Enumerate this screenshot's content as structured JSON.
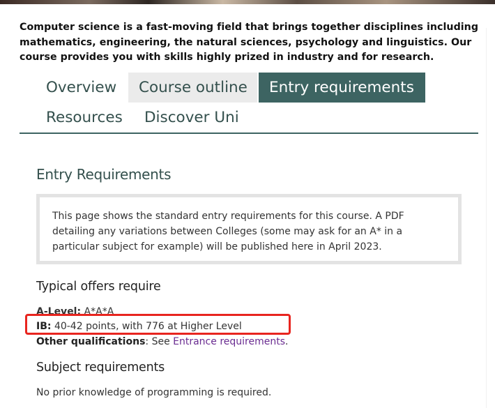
{
  "intro": "Computer science is a fast-moving field that brings together disciplines including mathematics, engineering, the natural sciences, psychology and linguistics. Our course provides you with skills highly prized in industry and for research.",
  "tabs": [
    {
      "label": "Overview"
    },
    {
      "label": "Course outline"
    },
    {
      "label": "Entry requirements"
    },
    {
      "label": "Resources"
    },
    {
      "label": "Discover Uni"
    }
  ],
  "section_title": "Entry Requirements",
  "notice": "This page shows the standard entry requirements for this course. A PDF detailing any variations between Colleges (some may ask for an A* in a particular subject for example) will be published here in April 2023.",
  "typical_offers": {
    "heading": "Typical offers require",
    "a_level_label": "A-Level:",
    "a_level_value": "A*A*A",
    "ib_label": "IB:",
    "ib_value": "40-42 points, with 776 at Higher Level",
    "other_label": "Other qualifications",
    "other_sep": ": See",
    "other_link": "Entrance requirements",
    "other_end": "."
  },
  "subject": {
    "heading": "Subject requirements",
    "text": "No prior knowledge of programming is required."
  },
  "colors": {
    "accent": "#3d6462",
    "tab_gray": "#ebebeb",
    "link": "#6a2c91",
    "highlight": "#e8251f"
  }
}
